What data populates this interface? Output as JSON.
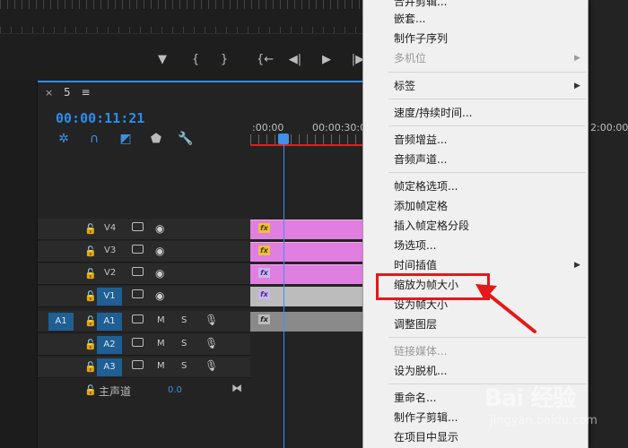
{
  "monitor": {
    "transport_buttons": [
      "▼",
      "{",
      "}",
      "{←",
      "◀|",
      "▶",
      "|▶"
    ]
  },
  "timeline": {
    "tab_close": "×",
    "tab_name": "5",
    "tab_menu": "≡",
    "timecode": "00:00:11:21",
    "ruler_labels": [
      ":00:00",
      "00:00:30:00"
    ],
    "right_ruler_label": "2:00:00",
    "tracks": [
      {
        "name": "V4",
        "kind": "video"
      },
      {
        "name": "V3",
        "kind": "video"
      },
      {
        "name": "V2",
        "kind": "video"
      },
      {
        "name": "V1",
        "kind": "video"
      },
      {
        "name": "A1",
        "kind": "audio",
        "source": "A1"
      },
      {
        "name": "A2",
        "kind": "audio"
      },
      {
        "name": "A3",
        "kind": "audio"
      }
    ],
    "audio_m": "M",
    "audio_s": "S",
    "master_label": "主声道",
    "master_value": "0.0",
    "fx_badge": "fx"
  },
  "context_menu": {
    "items": [
      {
        "label": "合并剪辑...",
        "disabled": false
      },
      {
        "label": "嵌套...",
        "disabled": false
      },
      {
        "label": "制作子序列",
        "disabled": false
      },
      {
        "label": "多机位",
        "disabled": true,
        "submenu": true
      },
      {
        "label": "标签",
        "disabled": false,
        "submenu": true
      },
      {
        "label": "速度/持续时间...",
        "disabled": false
      },
      {
        "label": "音频增益...",
        "disabled": false
      },
      {
        "label": "音频声道...",
        "disabled": false
      },
      {
        "label": "帧定格选项...",
        "disabled": false
      },
      {
        "label": "添加帧定格",
        "disabled": false
      },
      {
        "label": "插入帧定格分段",
        "disabled": false
      },
      {
        "label": "场选项...",
        "disabled": false
      },
      {
        "label": "时间插值",
        "disabled": false,
        "submenu": true
      },
      {
        "label": "缩放为帧大小",
        "disabled": false,
        "highlighted": true
      },
      {
        "label": "设为帧大小",
        "disabled": false
      },
      {
        "label": "调整图层",
        "disabled": false
      },
      {
        "label": "链接媒体...",
        "disabled": true
      },
      {
        "label": "设为脱机...",
        "disabled": false
      },
      {
        "label": "重命名...",
        "disabled": false
      },
      {
        "label": "制作子剪辑...",
        "disabled": false
      },
      {
        "label": "在项目中显示",
        "disabled": false
      }
    ]
  },
  "watermark": {
    "text": "Bai 经验",
    "url": "jingyan.baidu.com"
  },
  "colors": {
    "accent_blue": "#2d8ceb",
    "playhead_red": "#e0201e",
    "clip_pink": "#e07fe0",
    "annotation_red": "#e4181a"
  }
}
